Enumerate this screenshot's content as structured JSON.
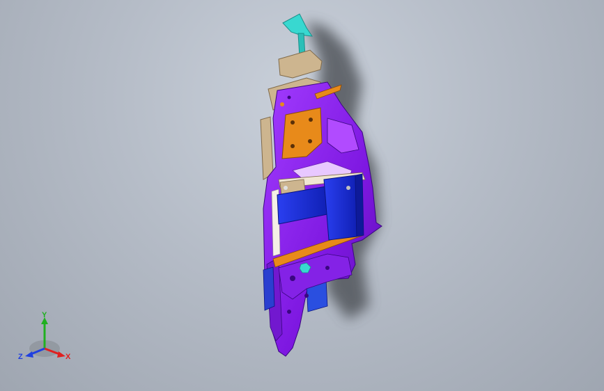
{
  "viewport": {
    "background_top": "#c9d0da",
    "background_bottom": "#9fa6b1"
  },
  "model": {
    "colors": {
      "purple": "#8a1fe8",
      "purple_dark": "#5a0fb0",
      "blue": "#1a2fd9",
      "orange": "#e88a1a",
      "tan": "#cdb58f",
      "cyan": "#38d8d0",
      "shadow": "#55595f"
    }
  },
  "triad": {
    "x_label": "X",
    "y_label": "Y",
    "z_label": "Z",
    "x_color": "#e02020",
    "y_color": "#20b020",
    "z_color": "#2040e0"
  }
}
